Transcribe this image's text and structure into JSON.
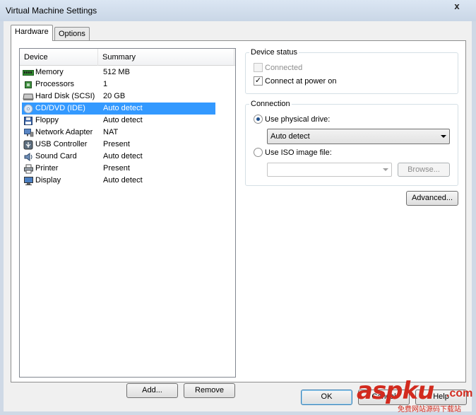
{
  "window": {
    "title": "Virtual Machine Settings",
    "close_glyph": "x"
  },
  "tabs": [
    {
      "label": "Hardware",
      "active": true
    },
    {
      "label": "Options",
      "active": false
    }
  ],
  "device_list": {
    "columns": [
      "Device",
      "Summary"
    ],
    "rows": [
      {
        "device": "Memory",
        "summary": "512 MB",
        "icon": "memory-icon",
        "selected": false
      },
      {
        "device": "Processors",
        "summary": "1",
        "icon": "processor-icon",
        "selected": false
      },
      {
        "device": "Hard Disk (SCSI)",
        "summary": "20 GB",
        "icon": "hard-disk-icon",
        "selected": false
      },
      {
        "device": "CD/DVD (IDE)",
        "summary": "Auto detect",
        "icon": "cd-dvd-icon",
        "selected": true
      },
      {
        "device": "Floppy",
        "summary": "Auto detect",
        "icon": "floppy-icon",
        "selected": false
      },
      {
        "device": "Network Adapter",
        "summary": "NAT",
        "icon": "network-adapter-icon",
        "selected": false
      },
      {
        "device": "USB Controller",
        "summary": "Present",
        "icon": "usb-icon",
        "selected": false
      },
      {
        "device": "Sound Card",
        "summary": "Auto detect",
        "icon": "speaker-icon",
        "selected": false
      },
      {
        "device": "Printer",
        "summary": "Present",
        "icon": "printer-icon",
        "selected": false
      },
      {
        "device": "Display",
        "summary": "Auto detect",
        "icon": "monitor-icon",
        "selected": false
      }
    ]
  },
  "device_buttons": {
    "add": "Add...",
    "remove": "Remove"
  },
  "device_status": {
    "title": "Device status",
    "connected_label": "Connected",
    "connected_checked": false,
    "connected_enabled": false,
    "power_on_label": "Connect at power on",
    "power_on_checked": true,
    "check_glyph": "✓"
  },
  "connection": {
    "title": "Connection",
    "physical_label": "Use physical drive:",
    "physical_selected": true,
    "physical_value": "Auto detect",
    "iso_label": "Use ISO image file:",
    "iso_selected": false,
    "iso_value": "",
    "browse_label": "Browse..."
  },
  "advanced_label": "Advanced...",
  "dialog_buttons": {
    "ok": "OK",
    "cancel": "Cancel",
    "help": "Help"
  },
  "watermark": {
    "brand": "aspku",
    "suffix": ".com",
    "tagline": "免费网站源码下载站"
  },
  "colors": {
    "selection": "#3399ff",
    "watermark": "#d22a1e"
  }
}
